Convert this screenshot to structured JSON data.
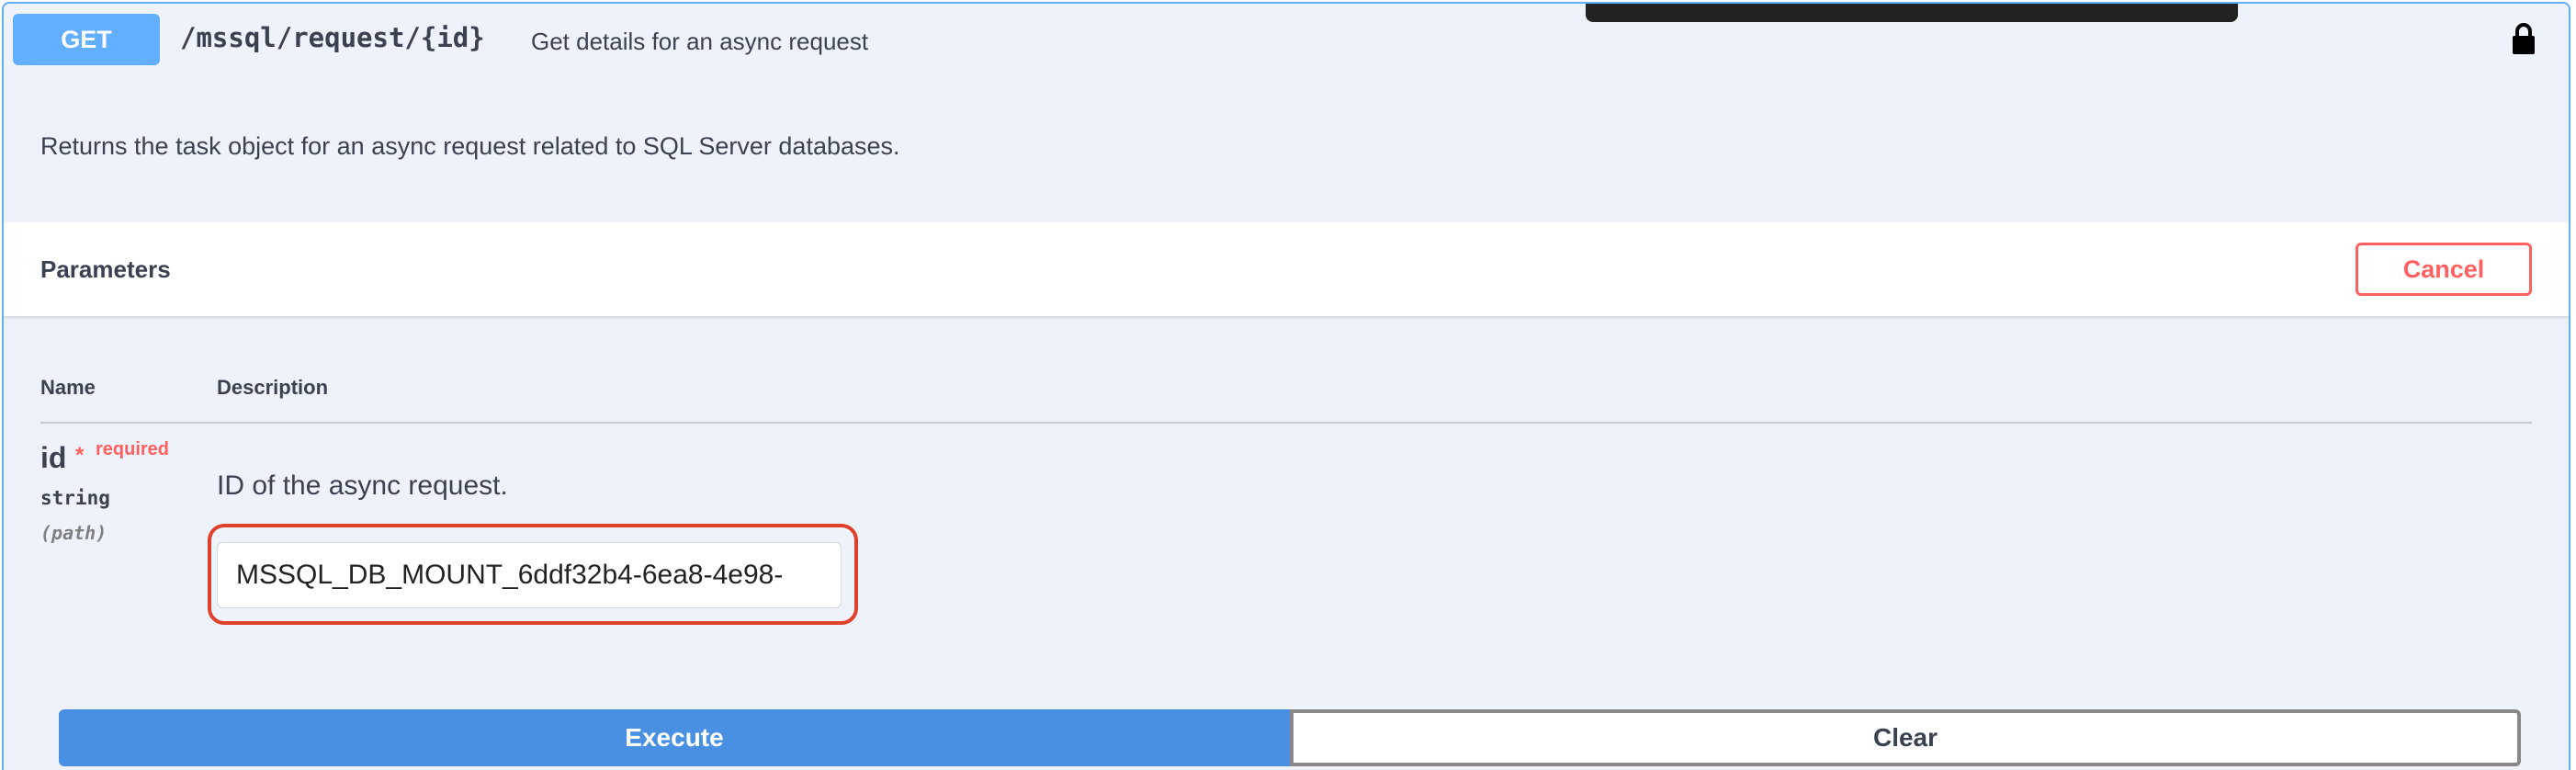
{
  "operation": {
    "method": "GET",
    "path": "/mssql/request/{id}",
    "summary": "Get details for an async request",
    "description": "Returns the task object for an async request related to SQL Server databases.",
    "lock_icon": "lock-icon"
  },
  "parameters": {
    "title": "Parameters",
    "cancel_label": "Cancel",
    "columns": {
      "name": "Name",
      "description": "Description"
    },
    "items": [
      {
        "name": "id",
        "required_star": "*",
        "required_label": "required",
        "type": "string",
        "in": "(path)",
        "description": "ID of the async request.",
        "value": "MSSQL_DB_MOUNT_6ddf32b4-6ea8-4e98-"
      }
    ]
  },
  "actions": {
    "execute_label": "Execute",
    "clear_label": "Clear"
  },
  "colors": {
    "get_method": "#61affe",
    "execute": "#4990e2",
    "required": "#ff6060",
    "highlight": "#e0412a"
  }
}
